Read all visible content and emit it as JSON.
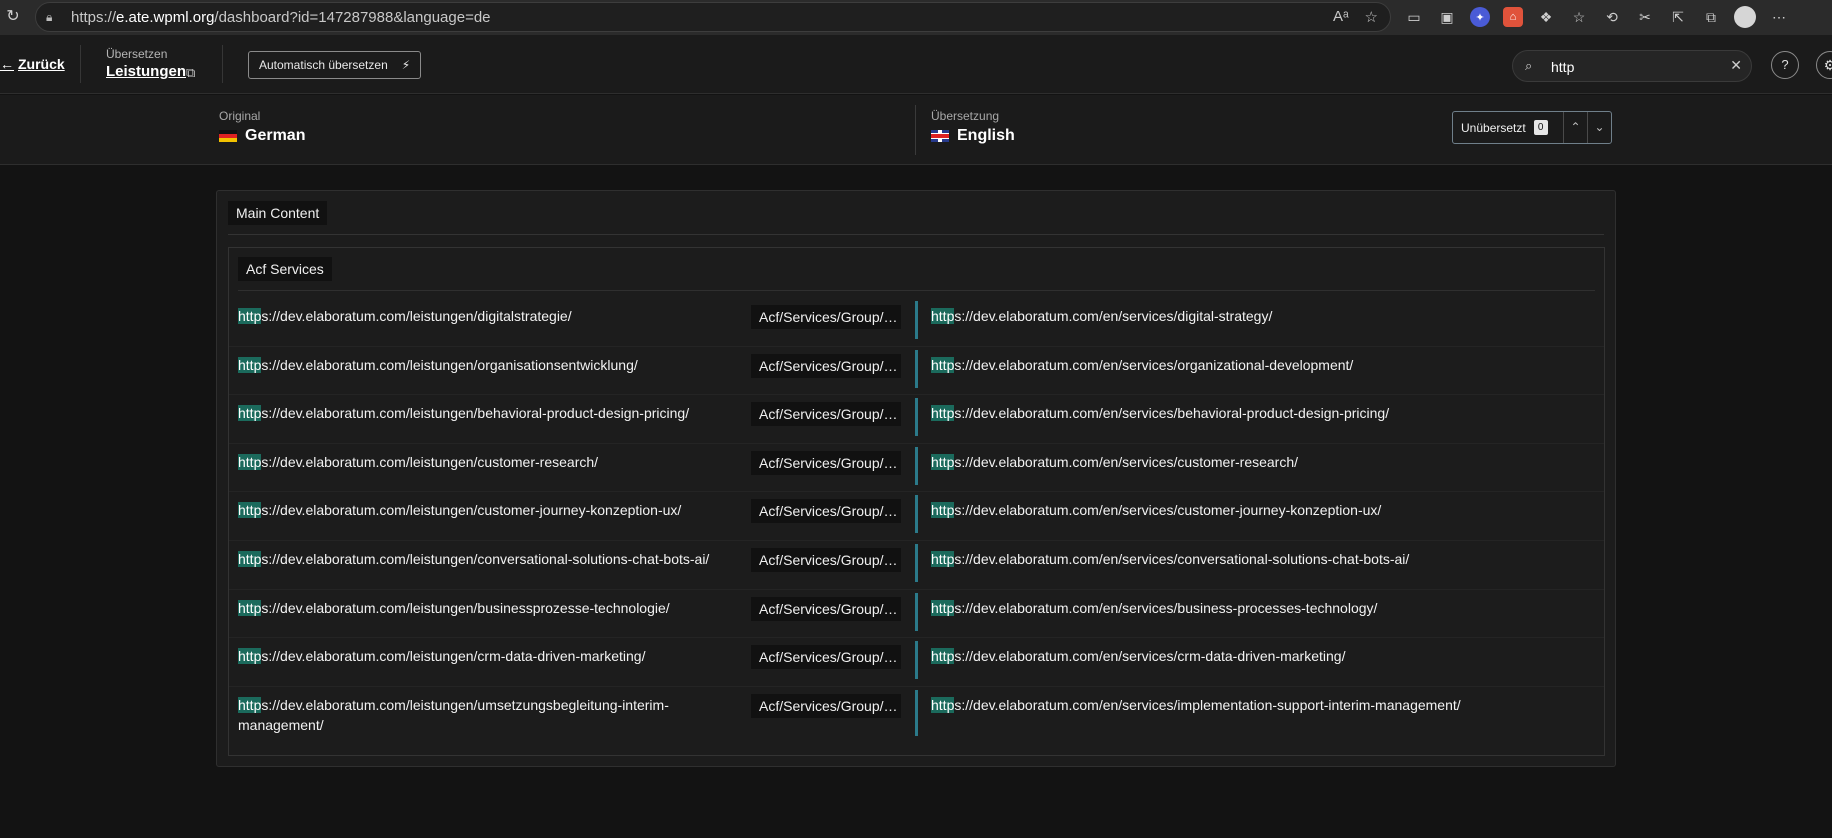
{
  "browser": {
    "url_prefix": "https://",
    "url_host": "e.ate.wpml.org",
    "url_rest": "/dashboard?id=147287988&language=de"
  },
  "header": {
    "back_label": "Zurück",
    "translate_label": "Übersetzen",
    "translate_name": "Leistungen",
    "auto_translate_label": "Automatisch übersetzen",
    "search_value": "http"
  },
  "languages": {
    "original_label": "Original",
    "original_name": "German",
    "translation_label": "Übersetzung",
    "translation_name": "English",
    "filter_label": "Unübersetzt",
    "filter_count": "0"
  },
  "content": {
    "section_title": "Main Content",
    "group_title": "Acf Services",
    "highlight": "http",
    "rows": [
      {
        "src": "s://dev.elaboratum.com/leistungen/digitalstrategie/",
        "badge": "Acf/Services/Group/Link",
        "tgt": "s://dev.elaboratum.com/en/services/digital-strategy/"
      },
      {
        "src": "s://dev.elaboratum.com/leistungen/organisationsentwicklung/",
        "badge": "Acf/Services/Group/Link",
        "tgt": "s://dev.elaboratum.com/en/services/organizational-development/"
      },
      {
        "src": "s://dev.elaboratum.com/leistungen/behavioral-product-design-pricing/",
        "badge": "Acf/Services/Group/Link",
        "tgt": "s://dev.elaboratum.com/en/services/behavioral-product-design-pricing/"
      },
      {
        "src": "s://dev.elaboratum.com/leistungen/customer-research/",
        "badge": "Acf/Services/Group/Link",
        "tgt": "s://dev.elaboratum.com/en/services/customer-research/"
      },
      {
        "src": "s://dev.elaboratum.com/leistungen/customer-journey-konzeption-ux/",
        "badge": "Acf/Services/Group/Link",
        "tgt": "s://dev.elaboratum.com/en/services/customer-journey-konzeption-ux/"
      },
      {
        "src": "s://dev.elaboratum.com/leistungen/conversational-solutions-chat-bots-ai/",
        "badge": "Acf/Services/Group/Link",
        "tgt": "s://dev.elaboratum.com/en/services/conversational-solutions-chat-bots-ai/"
      },
      {
        "src": "s://dev.elaboratum.com/leistungen/businessprozesse-technologie/",
        "badge": "Acf/Services/Group/Link",
        "tgt": "s://dev.elaboratum.com/en/services/business-processes-technology/"
      },
      {
        "src": "s://dev.elaboratum.com/leistungen/crm-data-driven-marketing/",
        "badge": "Acf/Services/Group/Link",
        "tgt": "s://dev.elaboratum.com/en/services/crm-data-driven-marketing/"
      },
      {
        "src": "s://dev.elaboratum.com/leistungen/umsetzungsbegleitung-interim-management/",
        "badge": "Acf/Services/Group/Link",
        "tgt": "s://dev.elaboratum.com/en/services/implementation-support-interim-management/"
      }
    ]
  }
}
